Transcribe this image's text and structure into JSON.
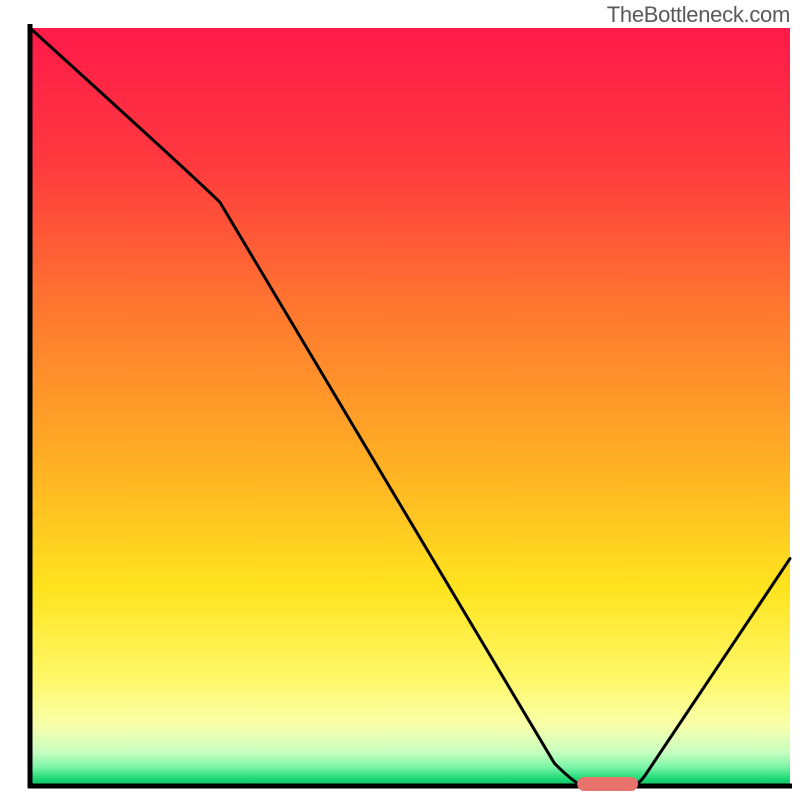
{
  "watermark": "TheBottleneck.com",
  "chart_data": {
    "type": "line",
    "title": "",
    "xlabel": "",
    "ylabel": "",
    "xlim": [
      0,
      100
    ],
    "ylim": [
      0,
      100
    ],
    "x": [
      0,
      25,
      72,
      80,
      100
    ],
    "values": [
      100,
      77,
      0,
      0,
      30
    ],
    "marker": {
      "x_range": [
        72,
        80
      ],
      "y": 0,
      "color": "#e8736b"
    },
    "gradient_stops": [
      {
        "offset": 0.0,
        "color": "#ff1a4a"
      },
      {
        "offset": 0.18,
        "color": "#ff3a3e"
      },
      {
        "offset": 0.38,
        "color": "#ff7a2f"
      },
      {
        "offset": 0.58,
        "color": "#ffb124"
      },
      {
        "offset": 0.74,
        "color": "#ffe41e"
      },
      {
        "offset": 0.86,
        "color": "#fff86a"
      },
      {
        "offset": 0.92,
        "color": "#f8ffaa"
      },
      {
        "offset": 0.955,
        "color": "#c8ffc0"
      },
      {
        "offset": 0.975,
        "color": "#7cf5a8"
      },
      {
        "offset": 0.99,
        "color": "#1ed977"
      },
      {
        "offset": 1.0,
        "color": "#0cc064"
      }
    ],
    "axis_color": "#000000"
  }
}
